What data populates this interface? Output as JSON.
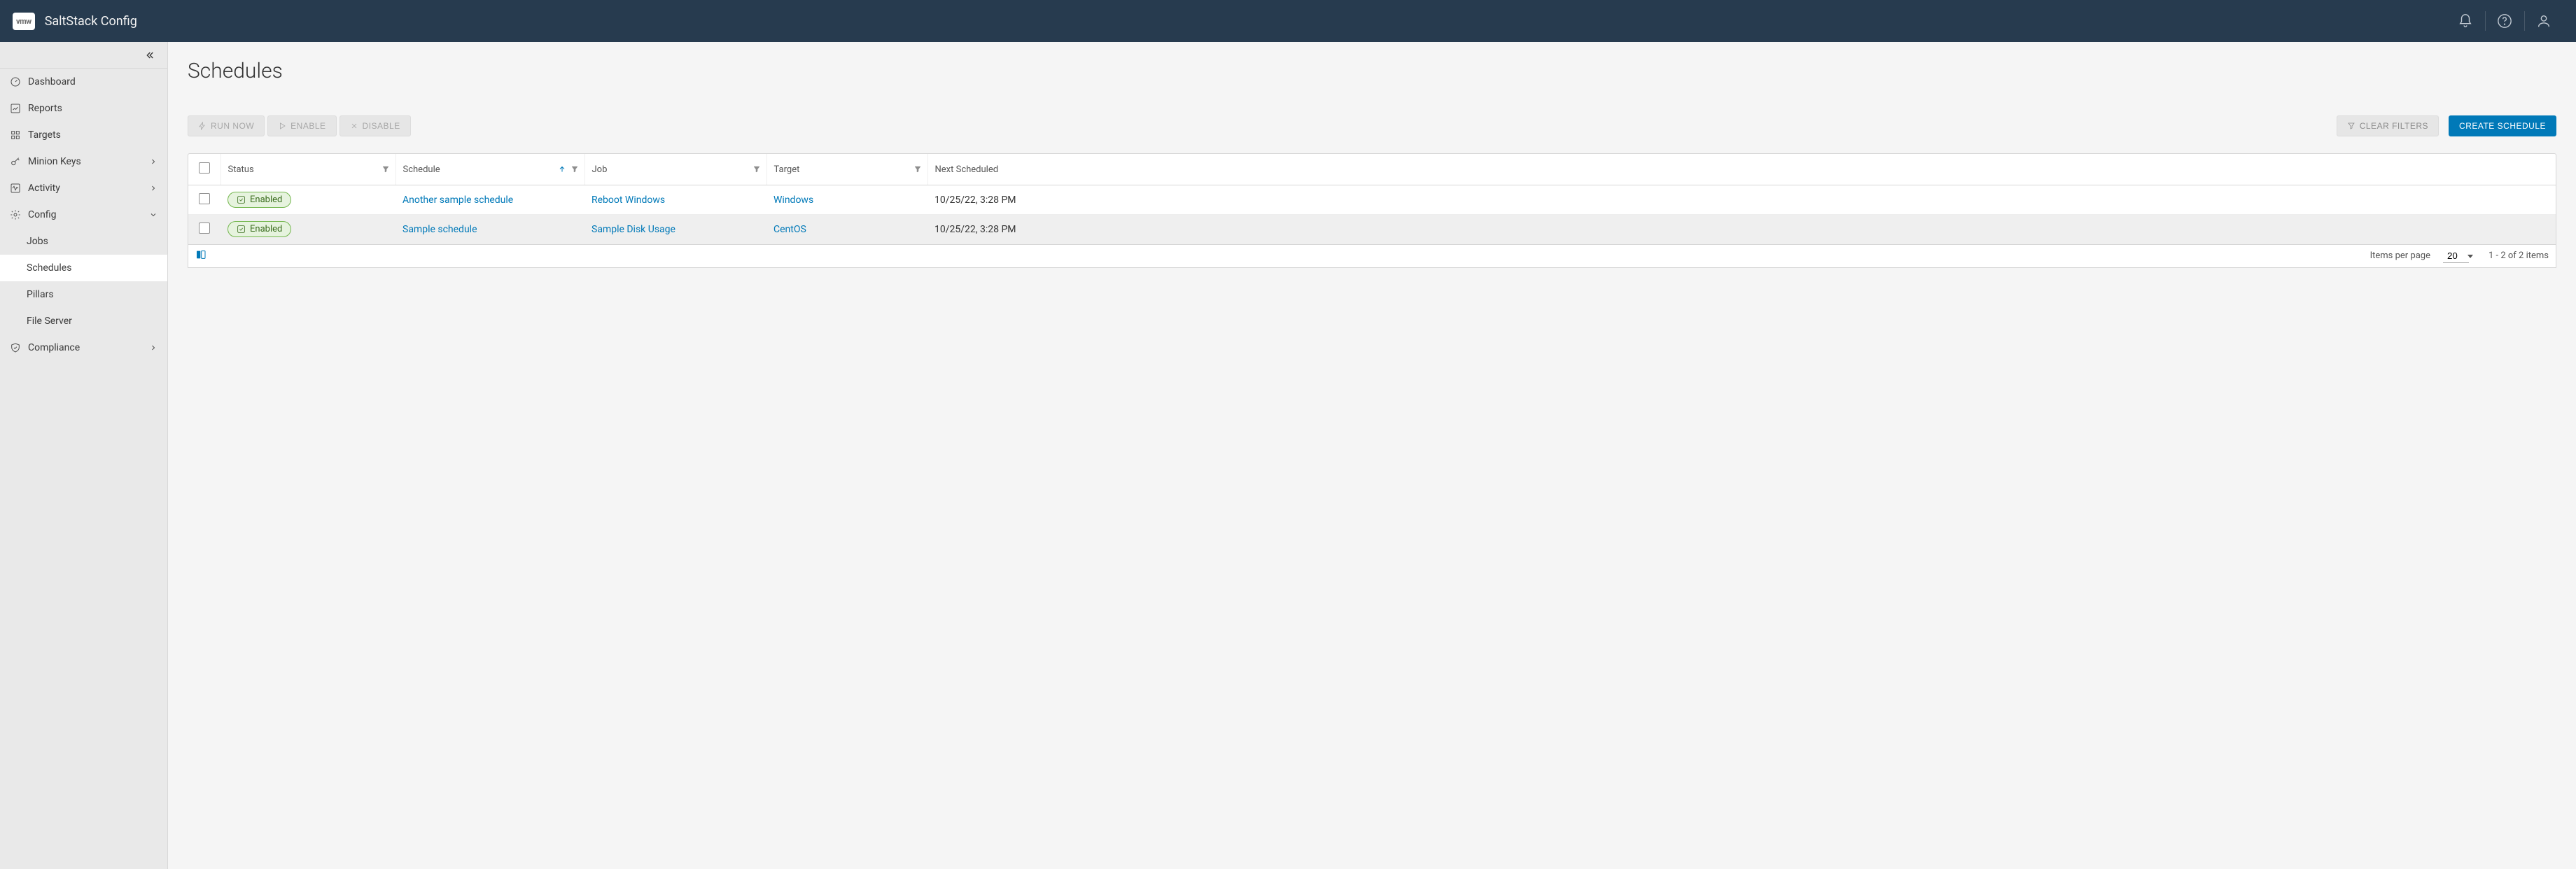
{
  "header": {
    "logo_text": "vmw",
    "app_name": "SaltStack Config"
  },
  "sidebar": {
    "items": [
      {
        "label": "Dashboard",
        "icon": "gauge-icon",
        "has_caret": false,
        "sub": []
      },
      {
        "label": "Reports",
        "icon": "chart-icon",
        "has_caret": false,
        "sub": []
      },
      {
        "label": "Targets",
        "icon": "grid-icon",
        "has_caret": false,
        "sub": []
      },
      {
        "label": "Minion Keys",
        "icon": "key-icon",
        "has_caret": true,
        "expanded": false,
        "sub": []
      },
      {
        "label": "Activity",
        "icon": "activity-icon",
        "has_caret": true,
        "expanded": false,
        "sub": []
      },
      {
        "label": "Config",
        "icon": "gear-icon",
        "has_caret": true,
        "expanded": true,
        "sub": [
          {
            "label": "Jobs",
            "active": false
          },
          {
            "label": "Schedules",
            "active": true
          },
          {
            "label": "Pillars",
            "active": false
          },
          {
            "label": "File Server",
            "active": false
          }
        ]
      },
      {
        "label": "Compliance",
        "icon": "shield-icon",
        "has_caret": true,
        "expanded": false,
        "sub": []
      }
    ]
  },
  "page": {
    "title": "Schedules",
    "actions": {
      "run_now": "Run Now",
      "enable": "Enable",
      "disable": "Disable",
      "clear_filters": "Clear Filters",
      "create": "Create Schedule"
    },
    "columns": {
      "status": "Status",
      "schedule": "Schedule",
      "job": "Job",
      "target": "Target",
      "next": "Next Scheduled"
    },
    "rows": [
      {
        "status": "Enabled",
        "schedule": "Another sample schedule",
        "job": "Reboot Windows",
        "target": "Windows",
        "next": "10/25/22, 3:28 PM"
      },
      {
        "status": "Enabled",
        "schedule": "Sample schedule",
        "job": "Sample Disk Usage",
        "target": "CentOS",
        "next": "10/25/22, 3:28 PM"
      }
    ],
    "footer": {
      "items_per_page_label": "Items per page",
      "page_size": "20",
      "range": "1 - 2 of 2 items"
    }
  }
}
